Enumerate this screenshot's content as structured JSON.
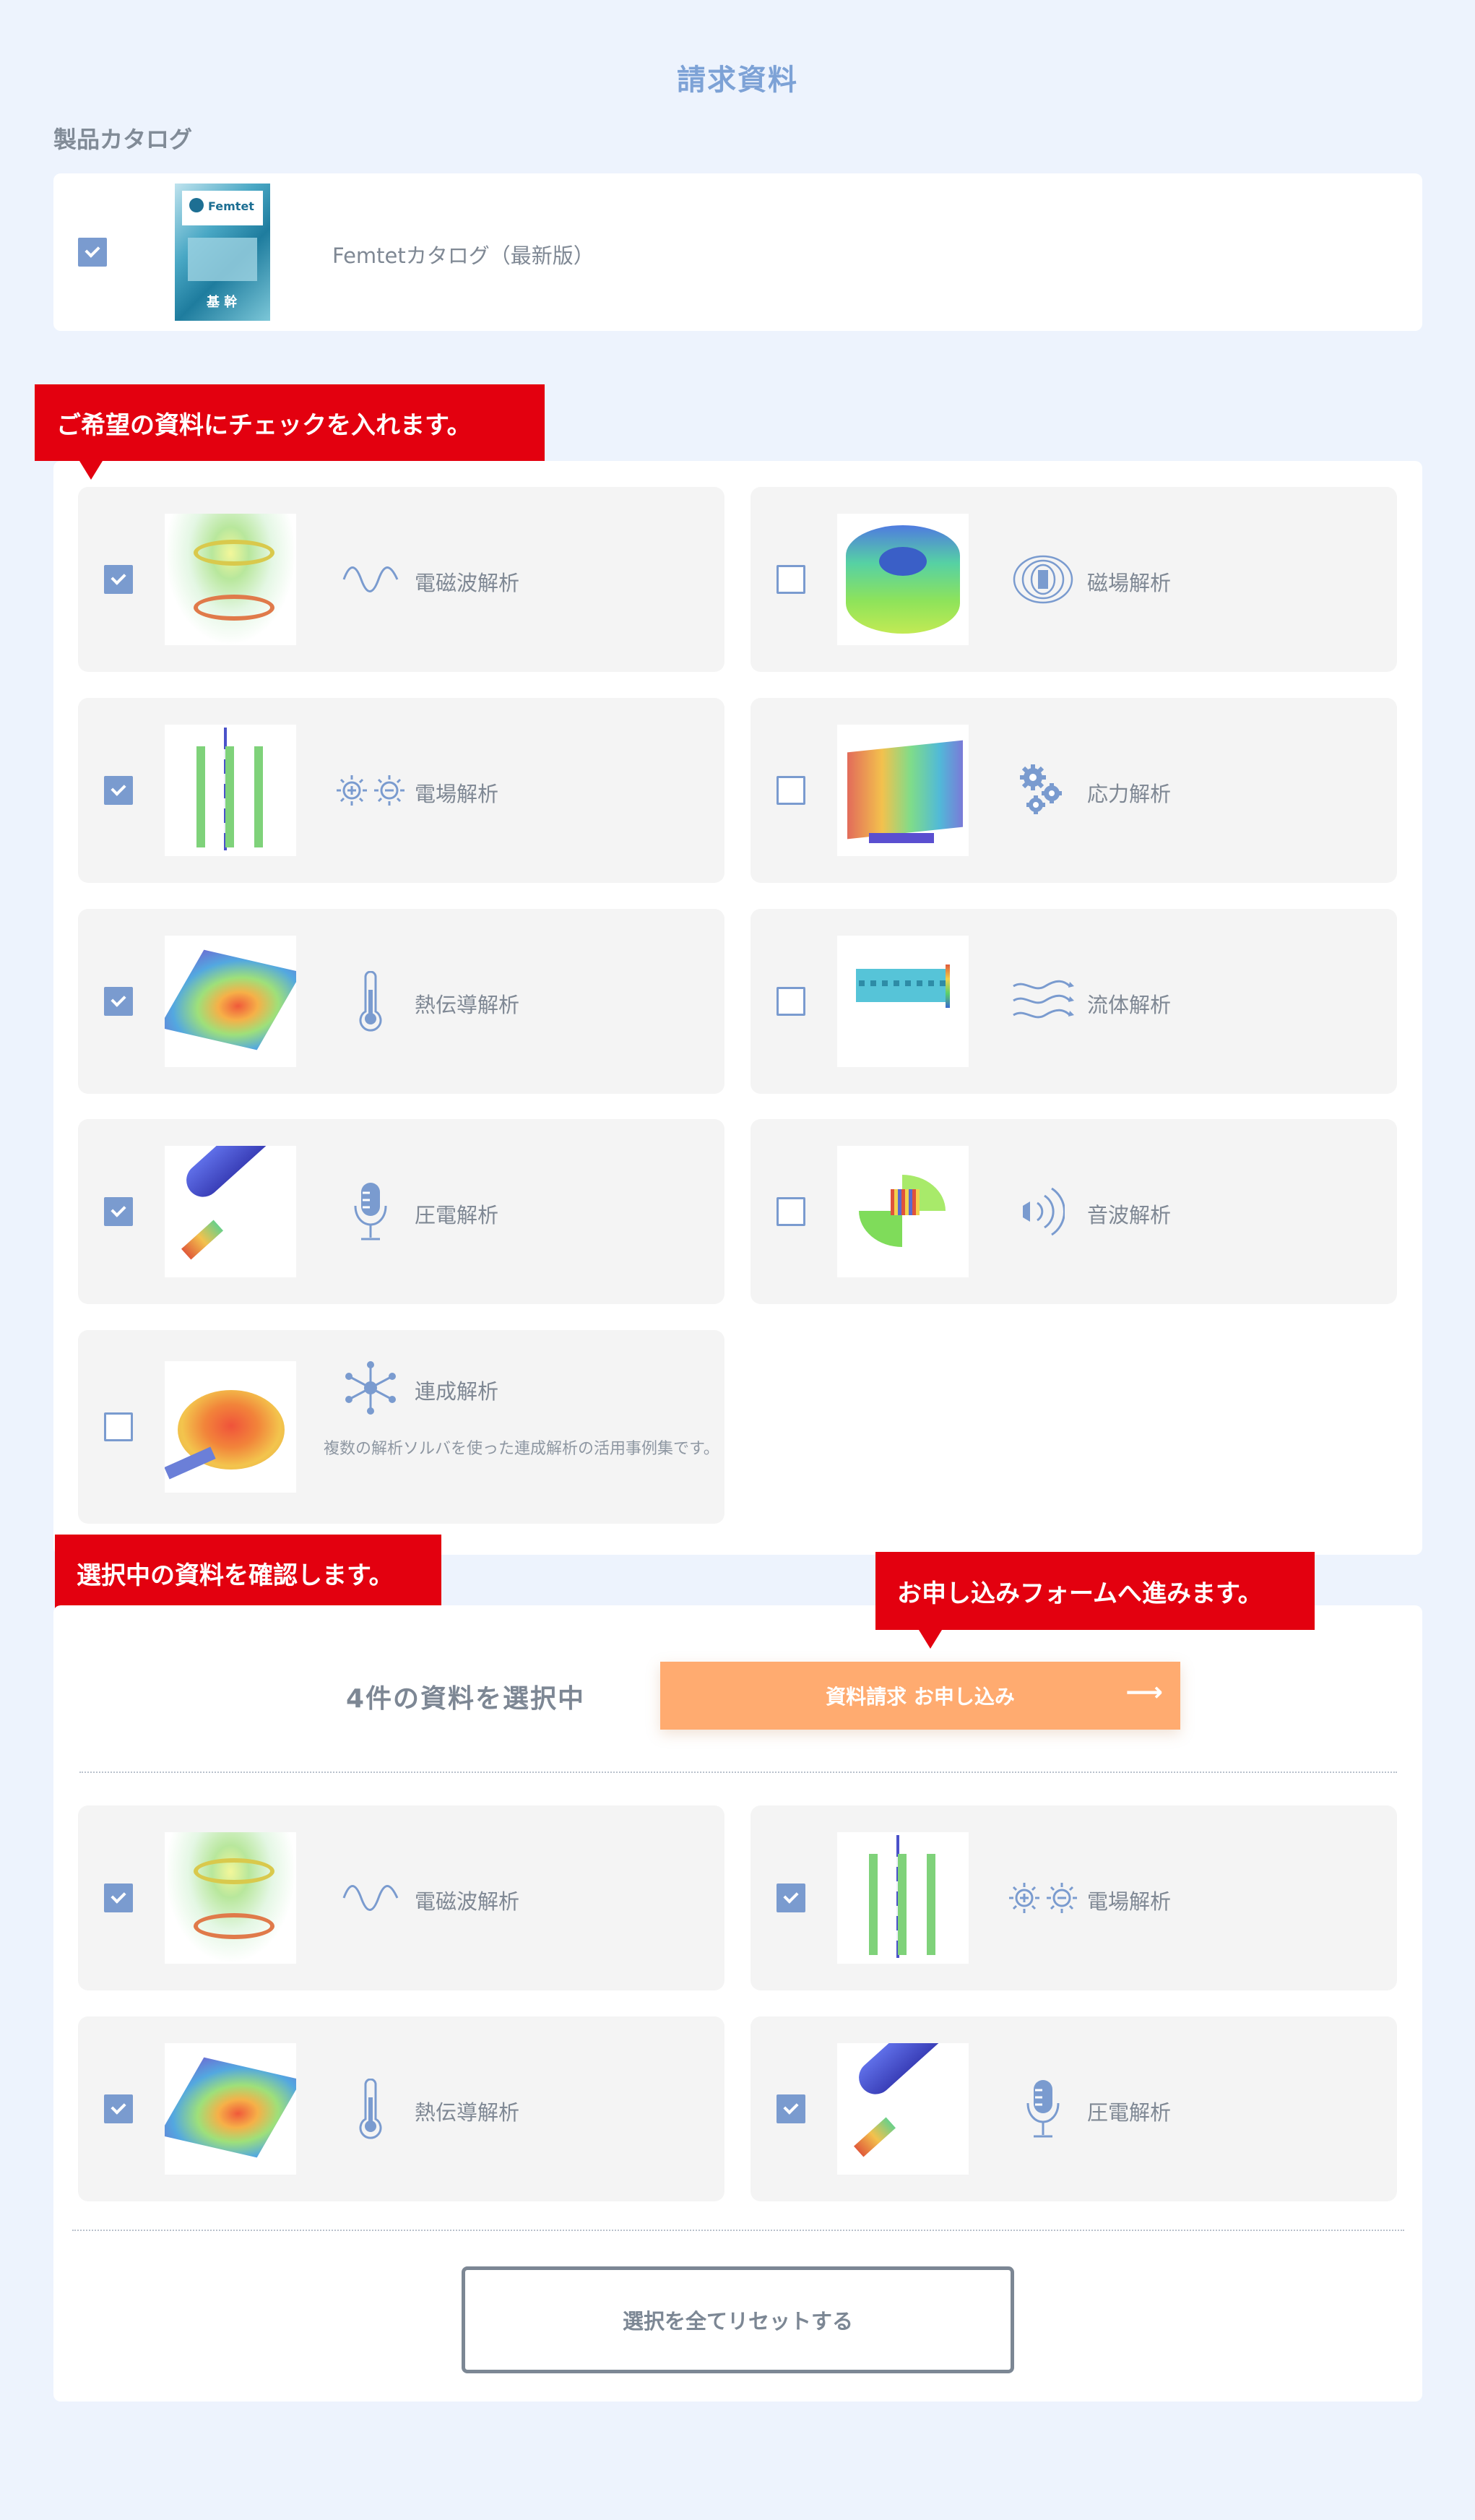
{
  "page_title": "請求資料",
  "catalog": {
    "section_title": "製品カタログ",
    "item_label": "Femtetカタログ（最新版）",
    "checked": true,
    "cover_brand": "Femtet",
    "cover_text": "基 幹"
  },
  "callouts": {
    "choose": "ご希望の資料にチェックを入れます。",
    "confirm": "選択中の資料を確認します。",
    "proceed": "お申し込みフォームへ進みます。"
  },
  "materials": [
    {
      "label": "電磁波解析",
      "checked": true,
      "icon": "sine-wave-icon"
    },
    {
      "label": "磁場解析",
      "checked": false,
      "icon": "magnet-field-icon"
    },
    {
      "label": "電場解析",
      "checked": true,
      "icon": "charge-icon"
    },
    {
      "label": "応力解析",
      "checked": false,
      "icon": "gears-icon"
    },
    {
      "label": "熱伝導解析",
      "checked": true,
      "icon": "thermometer-icon"
    },
    {
      "label": "流体解析",
      "checked": false,
      "icon": "wind-icon"
    },
    {
      "label": "圧電解析",
      "checked": true,
      "icon": "microphone-icon"
    },
    {
      "label": "音波解析",
      "checked": false,
      "icon": "speaker-wave-icon"
    },
    {
      "label": "連成解析",
      "checked": false,
      "icon": "network-icon",
      "description": "複数の解析ソルバを使った連成解析の活用事例集です。"
    }
  ],
  "selection": {
    "count_text": "4件の資料を選択中",
    "cta_label": "資料請求 お申し込み",
    "cta_arrow": "⟶",
    "items": [
      {
        "label": "電磁波解析",
        "checked": true,
        "icon": "sine-wave-icon"
      },
      {
        "label": "電場解析",
        "checked": true,
        "icon": "charge-icon"
      },
      {
        "label": "熱伝導解析",
        "checked": true,
        "icon": "thermometer-icon"
      },
      {
        "label": "圧電解析",
        "checked": true,
        "icon": "microphone-icon"
      }
    ],
    "reset_label": "選択を全てリセットする"
  },
  "colors": {
    "background": "#edf3fd",
    "accent_blue": "#7a9bcf",
    "callout_red": "#e3000f",
    "cta_orange": "#ffab70"
  }
}
